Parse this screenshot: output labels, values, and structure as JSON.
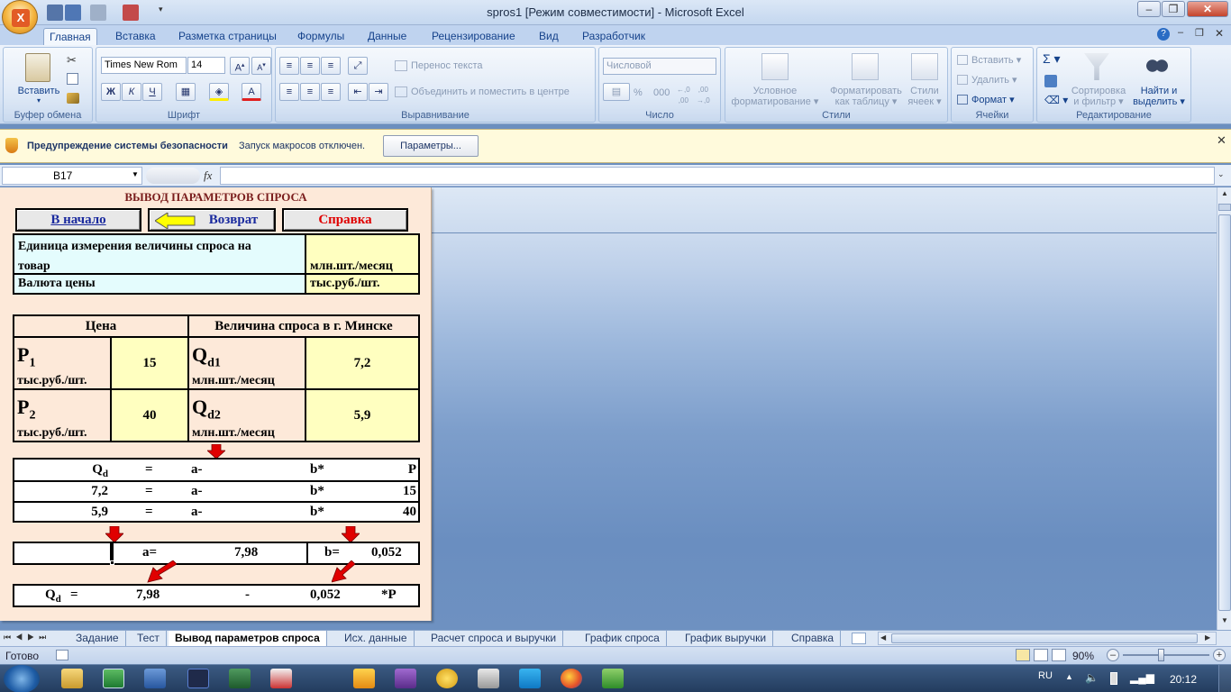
{
  "window": {
    "title": "spros1  [Режим совместимости] - Microsoft Excel",
    "office_logo": "X"
  },
  "tabs": [
    "Главная",
    "Вставка",
    "Разметка страницы",
    "Формулы",
    "Данные",
    "Рецензирование",
    "Вид",
    "Разработчик"
  ],
  "ribbon": {
    "paste": "Вставить",
    "clipboard_label": "Буфер обмена",
    "font_name": "Times New Rom",
    "font_size": "14",
    "font_label": "Шрифт",
    "bold": "Ж",
    "italic": "К",
    "underline": "Ч",
    "wrap_text": "Перенос текста",
    "merge_center": "Объединить и поместить в центре",
    "alignment_label": "Выравнивание",
    "number_format": "Числовой",
    "percent": "%",
    "thousands": "000",
    "number_label": "Число",
    "cond_format_1": "Условное",
    "cond_format_2": "форматирование",
    "format_table_1": "Форматировать",
    "format_table_2": "как таблицу",
    "cell_styles_1": "Стили",
    "cell_styles_2": "ячеек",
    "styles_label": "Стили",
    "insert": "Вставить",
    "delete": "Удалить",
    "format": "Формат",
    "cells_label": "Ячейки",
    "sort_1": "Сортировка",
    "sort_2": "и фильтр",
    "find_1": "Найти и",
    "find_2": "выделить",
    "editing_label": "Редактирование"
  },
  "security": {
    "title": "Предупреждение системы безопасности",
    "message": "Запуск макросов отключен.",
    "button": "Параметры..."
  },
  "formula_bar": {
    "name_box": "B17",
    "fx": "fx",
    "formula": ""
  },
  "sheet": {
    "heading": "ВЫВОД ПАРАМЕТРОВ СПРОСА",
    "btn_start": "В начало",
    "btn_back": "Возврат",
    "btn_help": "Справка",
    "unit_label_1": "Единица измерения величины спроса на",
    "unit_label_2": "товар",
    "unit_value": "млн.шт./месяц",
    "currency_label": "Валюта цены",
    "currency_value": "тыс.руб./шт.",
    "price_header": "Цена",
    "demand_header": "Величина спроса в г. Минске",
    "p1": "P",
    "p1_sub": "1",
    "p1_unit": "тыс.руб./шт.",
    "p1_value": "15",
    "q1": "Q",
    "q1_sub": "d1",
    "q1_unit": "млн.шт./месяц",
    "q1_value": "7,2",
    "p2": "P",
    "p2_sub": "2",
    "p2_unit": "тыс.руб./шт.",
    "p2_value": "40",
    "q2": "Q",
    "q2_sub": "d2",
    "q2_unit": "млн.шт./месяц",
    "q2_value": "5,9",
    "eq_rows": [
      {
        "lhs": "Q",
        "lhs_sub": "d",
        "eq": "=",
        "a": "a-",
        "b": "b*",
        "rhs": "P"
      },
      {
        "lhs": "7,2",
        "lhs_sub": "",
        "eq": "=",
        "a": "a-",
        "b": "b*",
        "rhs": "15"
      },
      {
        "lhs": "5,9",
        "lhs_sub": "",
        "eq": "=",
        "a": "a-",
        "b": "b*",
        "rhs": "40"
      }
    ],
    "a_label": "a=",
    "a_value": "7,98",
    "b_label": "b=",
    "b_value": "0,052",
    "result_q": "Q",
    "result_q_sub": "d",
    "result_eq": "=",
    "result_a": "7,98",
    "result_minus": "-",
    "result_b": "0,052",
    "result_p": "*P"
  },
  "sheet_tabs": [
    "Задание",
    "Тест",
    "Вывод параметров спроса",
    "Исх. данные",
    "Расчет спроса и выручки",
    "График спроса",
    "График выручки",
    "Справка"
  ],
  "active_sheet": "Вывод параметров спроса",
  "status": {
    "ready": "Готово",
    "zoom": "90%"
  },
  "taskbar": {
    "lang": "RU",
    "time": "20:12"
  }
}
